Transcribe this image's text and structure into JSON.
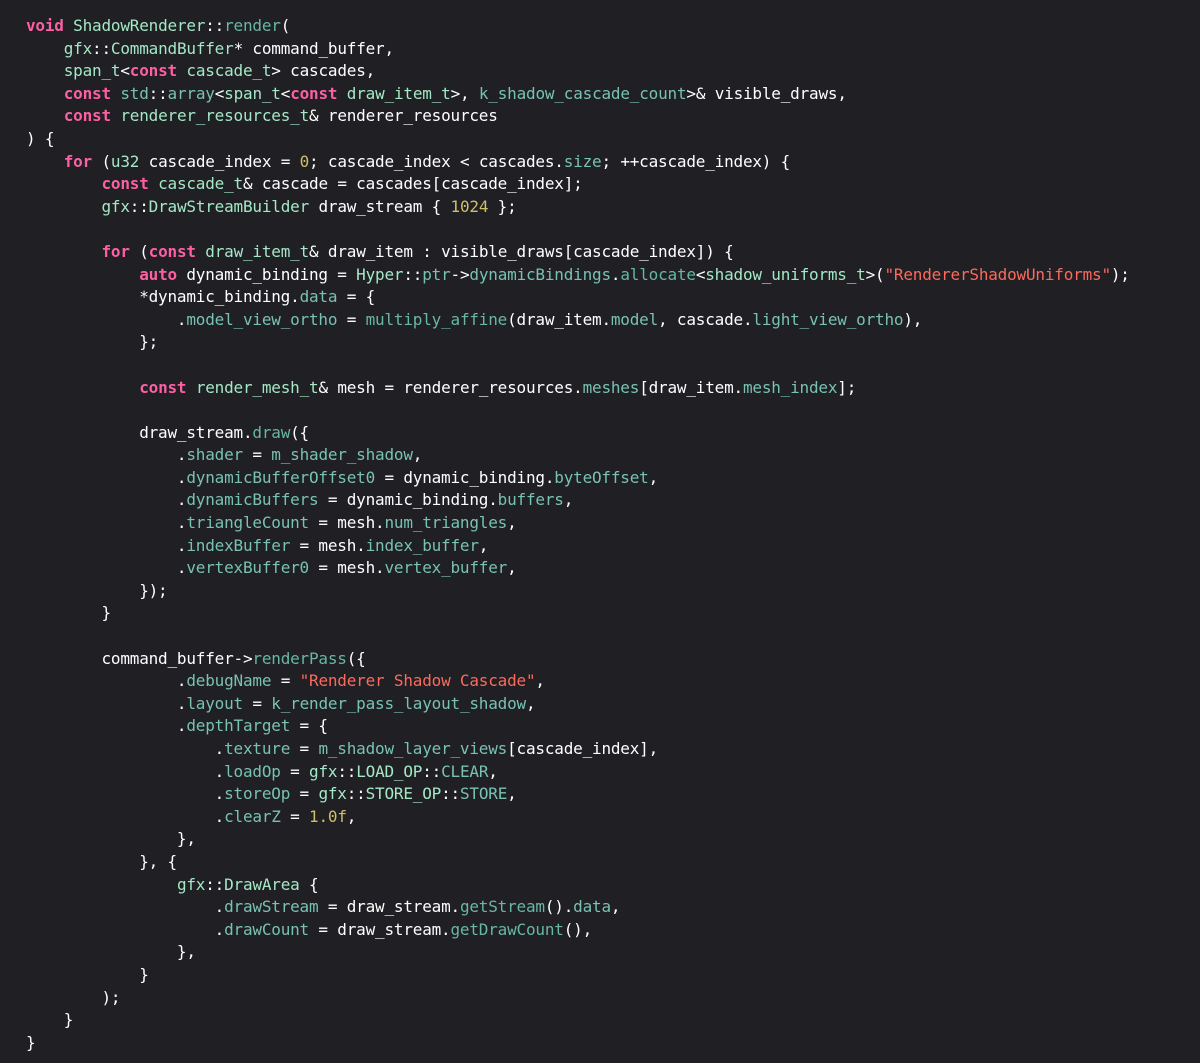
{
  "editor": {
    "background": "#1f1f24",
    "colors": {
      "kw": "#fc5fa3",
      "type": "#a4e8c5",
      "func": "#67b7a4",
      "prop": "#78c2b3",
      "str": "#fc6a5d",
      "num": "#d0bf69",
      "plain": "#ffffff"
    },
    "lines": [
      [
        [
          "kw",
          "void"
        ],
        [
          "plain",
          " "
        ],
        [
          "type",
          "ShadowRenderer"
        ],
        [
          "plain",
          "::"
        ],
        [
          "func",
          "render"
        ],
        [
          "plain",
          "("
        ]
      ],
      [
        [
          "plain",
          "    "
        ],
        [
          "type",
          "gfx"
        ],
        [
          "plain",
          "::"
        ],
        [
          "type",
          "CommandBuffer"
        ],
        [
          "plain",
          "* command_buffer,"
        ]
      ],
      [
        [
          "plain",
          "    "
        ],
        [
          "type",
          "span_t"
        ],
        [
          "plain",
          "<"
        ],
        [
          "kw",
          "const"
        ],
        [
          "plain",
          " "
        ],
        [
          "type",
          "cascade_t"
        ],
        [
          "plain",
          "> cascades,"
        ]
      ],
      [
        [
          "plain",
          "    "
        ],
        [
          "kw",
          "const"
        ],
        [
          "plain",
          " "
        ],
        [
          "prop",
          "std"
        ],
        [
          "plain",
          "::"
        ],
        [
          "prop",
          "array"
        ],
        [
          "plain",
          "<"
        ],
        [
          "type",
          "span_t"
        ],
        [
          "plain",
          "<"
        ],
        [
          "kw",
          "const"
        ],
        [
          "plain",
          " "
        ],
        [
          "type",
          "draw_item_t"
        ],
        [
          "plain",
          ">, "
        ],
        [
          "prop",
          "k_shadow_cascade_count"
        ],
        [
          "plain",
          ">& visible_draws,"
        ]
      ],
      [
        [
          "plain",
          "    "
        ],
        [
          "kw",
          "const"
        ],
        [
          "plain",
          " "
        ],
        [
          "type",
          "renderer_resources_t"
        ],
        [
          "plain",
          "& renderer_resources"
        ]
      ],
      [
        [
          "plain",
          ") {"
        ]
      ],
      [
        [
          "plain",
          "    "
        ],
        [
          "kw",
          "for"
        ],
        [
          "plain",
          " ("
        ],
        [
          "type",
          "u32"
        ],
        [
          "plain",
          " cascade_index = "
        ],
        [
          "num",
          "0"
        ],
        [
          "plain",
          "; cascade_index < cascades."
        ],
        [
          "prop",
          "size"
        ],
        [
          "plain",
          "; ++cascade_index) {"
        ]
      ],
      [
        [
          "plain",
          "        "
        ],
        [
          "kw",
          "const"
        ],
        [
          "plain",
          " "
        ],
        [
          "type",
          "cascade_t"
        ],
        [
          "plain",
          "& cascade = cascades[cascade_index];"
        ]
      ],
      [
        [
          "plain",
          "        "
        ],
        [
          "type",
          "gfx"
        ],
        [
          "plain",
          "::"
        ],
        [
          "type",
          "DrawStreamBuilder"
        ],
        [
          "plain",
          " draw_stream { "
        ],
        [
          "num",
          "1024"
        ],
        [
          "plain",
          " };"
        ]
      ],
      [
        [
          "plain",
          ""
        ]
      ],
      [
        [
          "plain",
          "        "
        ],
        [
          "kw",
          "for"
        ],
        [
          "plain",
          " ("
        ],
        [
          "kw",
          "const"
        ],
        [
          "plain",
          " "
        ],
        [
          "type",
          "draw_item_t"
        ],
        [
          "plain",
          "& draw_item : visible_draws[cascade_index]) {"
        ]
      ],
      [
        [
          "plain",
          "            "
        ],
        [
          "kw",
          "auto"
        ],
        [
          "plain",
          " dynamic_binding = "
        ],
        [
          "type",
          "Hyper"
        ],
        [
          "plain",
          "::"
        ],
        [
          "prop",
          "ptr"
        ],
        [
          "plain",
          "->"
        ],
        [
          "prop",
          "dynamicBindings"
        ],
        [
          "plain",
          "."
        ],
        [
          "func",
          "allocate"
        ],
        [
          "plain",
          "<"
        ],
        [
          "type",
          "shadow_uniforms_t"
        ],
        [
          "plain",
          ">("
        ],
        [
          "str",
          "\"RendererShadowUniforms\""
        ],
        [
          "plain",
          ");"
        ]
      ],
      [
        [
          "plain",
          "            *dynamic_binding."
        ],
        [
          "prop",
          "data"
        ],
        [
          "plain",
          " = {"
        ]
      ],
      [
        [
          "plain",
          "                ."
        ],
        [
          "prop",
          "model_view_ortho"
        ],
        [
          "plain",
          " = "
        ],
        [
          "func",
          "multiply_affine"
        ],
        [
          "plain",
          "(draw_item."
        ],
        [
          "prop",
          "model"
        ],
        [
          "plain",
          ", cascade."
        ],
        [
          "prop",
          "light_view_ortho"
        ],
        [
          "plain",
          "),"
        ]
      ],
      [
        [
          "plain",
          "            };"
        ]
      ],
      [
        [
          "plain",
          ""
        ]
      ],
      [
        [
          "plain",
          "            "
        ],
        [
          "kw",
          "const"
        ],
        [
          "plain",
          " "
        ],
        [
          "type",
          "render_mesh_t"
        ],
        [
          "plain",
          "& mesh = renderer_resources."
        ],
        [
          "prop",
          "meshes"
        ],
        [
          "plain",
          "[draw_item."
        ],
        [
          "prop",
          "mesh_index"
        ],
        [
          "plain",
          "];"
        ]
      ],
      [
        [
          "plain",
          ""
        ]
      ],
      [
        [
          "plain",
          "            draw_stream."
        ],
        [
          "func",
          "draw"
        ],
        [
          "plain",
          "({"
        ]
      ],
      [
        [
          "plain",
          "                ."
        ],
        [
          "prop",
          "shader"
        ],
        [
          "plain",
          " = "
        ],
        [
          "prop",
          "m_shader_shadow"
        ],
        [
          "plain",
          ","
        ]
      ],
      [
        [
          "plain",
          "                ."
        ],
        [
          "prop",
          "dynamicBufferOffset0"
        ],
        [
          "plain",
          " = dynamic_binding."
        ],
        [
          "prop",
          "byteOffset"
        ],
        [
          "plain",
          ","
        ]
      ],
      [
        [
          "plain",
          "                ."
        ],
        [
          "prop",
          "dynamicBuffers"
        ],
        [
          "plain",
          " = dynamic_binding."
        ],
        [
          "prop",
          "buffers"
        ],
        [
          "plain",
          ","
        ]
      ],
      [
        [
          "plain",
          "                ."
        ],
        [
          "prop",
          "triangleCount"
        ],
        [
          "plain",
          " = mesh."
        ],
        [
          "prop",
          "num_triangles"
        ],
        [
          "plain",
          ","
        ]
      ],
      [
        [
          "plain",
          "                ."
        ],
        [
          "prop",
          "indexBuffer"
        ],
        [
          "plain",
          " = mesh."
        ],
        [
          "prop",
          "index_buffer"
        ],
        [
          "plain",
          ","
        ]
      ],
      [
        [
          "plain",
          "                ."
        ],
        [
          "prop",
          "vertexBuffer0"
        ],
        [
          "plain",
          " = mesh."
        ],
        [
          "prop",
          "vertex_buffer"
        ],
        [
          "plain",
          ","
        ]
      ],
      [
        [
          "plain",
          "            });"
        ]
      ],
      [
        [
          "plain",
          "        }"
        ]
      ],
      [
        [
          "plain",
          ""
        ]
      ],
      [
        [
          "plain",
          "        command_buffer->"
        ],
        [
          "func",
          "renderPass"
        ],
        [
          "plain",
          "({"
        ]
      ],
      [
        [
          "plain",
          "                ."
        ],
        [
          "prop",
          "debugName"
        ],
        [
          "plain",
          " = "
        ],
        [
          "str",
          "\"Renderer Shadow Cascade\""
        ],
        [
          "plain",
          ","
        ]
      ],
      [
        [
          "plain",
          "                ."
        ],
        [
          "prop",
          "layout"
        ],
        [
          "plain",
          " = "
        ],
        [
          "prop",
          "k_render_pass_layout_shadow"
        ],
        [
          "plain",
          ","
        ]
      ],
      [
        [
          "plain",
          "                ."
        ],
        [
          "prop",
          "depthTarget"
        ],
        [
          "plain",
          " = {"
        ]
      ],
      [
        [
          "plain",
          "                    ."
        ],
        [
          "prop",
          "texture"
        ],
        [
          "plain",
          " = "
        ],
        [
          "prop",
          "m_shadow_layer_views"
        ],
        [
          "plain",
          "[cascade_index],"
        ]
      ],
      [
        [
          "plain",
          "                    ."
        ],
        [
          "prop",
          "loadOp"
        ],
        [
          "plain",
          " = "
        ],
        [
          "type",
          "gfx"
        ],
        [
          "plain",
          "::"
        ],
        [
          "type",
          "LOAD_OP"
        ],
        [
          "plain",
          "::"
        ],
        [
          "prop",
          "CLEAR"
        ],
        [
          "plain",
          ","
        ]
      ],
      [
        [
          "plain",
          "                    ."
        ],
        [
          "prop",
          "storeOp"
        ],
        [
          "plain",
          " = "
        ],
        [
          "type",
          "gfx"
        ],
        [
          "plain",
          "::"
        ],
        [
          "type",
          "STORE_OP"
        ],
        [
          "plain",
          "::"
        ],
        [
          "prop",
          "STORE"
        ],
        [
          "plain",
          ","
        ]
      ],
      [
        [
          "plain",
          "                    ."
        ],
        [
          "prop",
          "clearZ"
        ],
        [
          "plain",
          " = "
        ],
        [
          "num",
          "1.0f"
        ],
        [
          "plain",
          ","
        ]
      ],
      [
        [
          "plain",
          "                },"
        ]
      ],
      [
        [
          "plain",
          "            }, {"
        ]
      ],
      [
        [
          "plain",
          "                "
        ],
        [
          "type",
          "gfx"
        ],
        [
          "plain",
          "::"
        ],
        [
          "type",
          "DrawArea"
        ],
        [
          "plain",
          " {"
        ]
      ],
      [
        [
          "plain",
          "                    ."
        ],
        [
          "prop",
          "drawStream"
        ],
        [
          "plain",
          " = draw_stream."
        ],
        [
          "func",
          "getStream"
        ],
        [
          "plain",
          "()."
        ],
        [
          "prop",
          "data"
        ],
        [
          "plain",
          ","
        ]
      ],
      [
        [
          "plain",
          "                    ."
        ],
        [
          "prop",
          "drawCount"
        ],
        [
          "plain",
          " = draw_stream."
        ],
        [
          "func",
          "getDrawCount"
        ],
        [
          "plain",
          "(),"
        ]
      ],
      [
        [
          "plain",
          "                },"
        ]
      ],
      [
        [
          "plain",
          "            }"
        ]
      ],
      [
        [
          "plain",
          "        );"
        ]
      ],
      [
        [
          "plain",
          "    }"
        ]
      ],
      [
        [
          "plain",
          "}"
        ]
      ]
    ]
  }
}
